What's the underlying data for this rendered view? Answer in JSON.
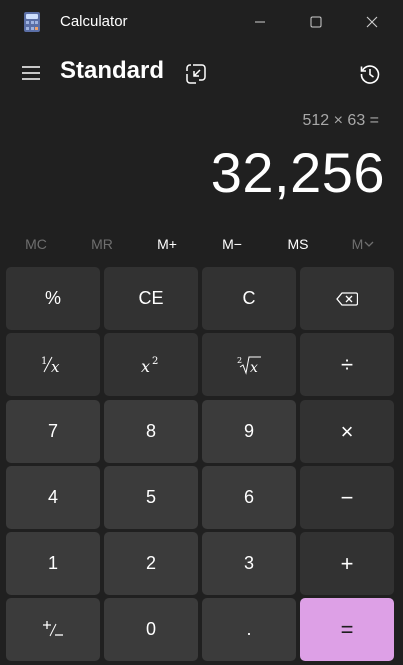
{
  "window": {
    "title": "Calculator"
  },
  "header": {
    "mode": "Standard"
  },
  "display": {
    "expression": "512 × 63 =",
    "result": "32,256"
  },
  "memory": {
    "mc": "MC",
    "mr": "MR",
    "m_plus": "M+",
    "m_minus": "M−",
    "ms": "MS",
    "m_list": "M"
  },
  "keys": {
    "percent": "%",
    "ce": "CE",
    "c": "C",
    "seven": "7",
    "eight": "8",
    "nine": "9",
    "multiply": "×",
    "four": "4",
    "five": "5",
    "six": "6",
    "minus": "−",
    "one": "1",
    "two": "2",
    "three": "3",
    "plus": "+",
    "zero": "0",
    "decimal": ".",
    "equals": "=",
    "divide": "÷"
  },
  "colors": {
    "background": "#202020",
    "key": "#323232",
    "number_key": "#3b3b3b",
    "accent": "#dda0e6"
  },
  "icons": {
    "app": "calculator-app-icon",
    "menu": "hamburger-icon",
    "keep_on_top": "keep-on-top-icon",
    "history": "history-icon",
    "backspace": "backspace-icon"
  }
}
